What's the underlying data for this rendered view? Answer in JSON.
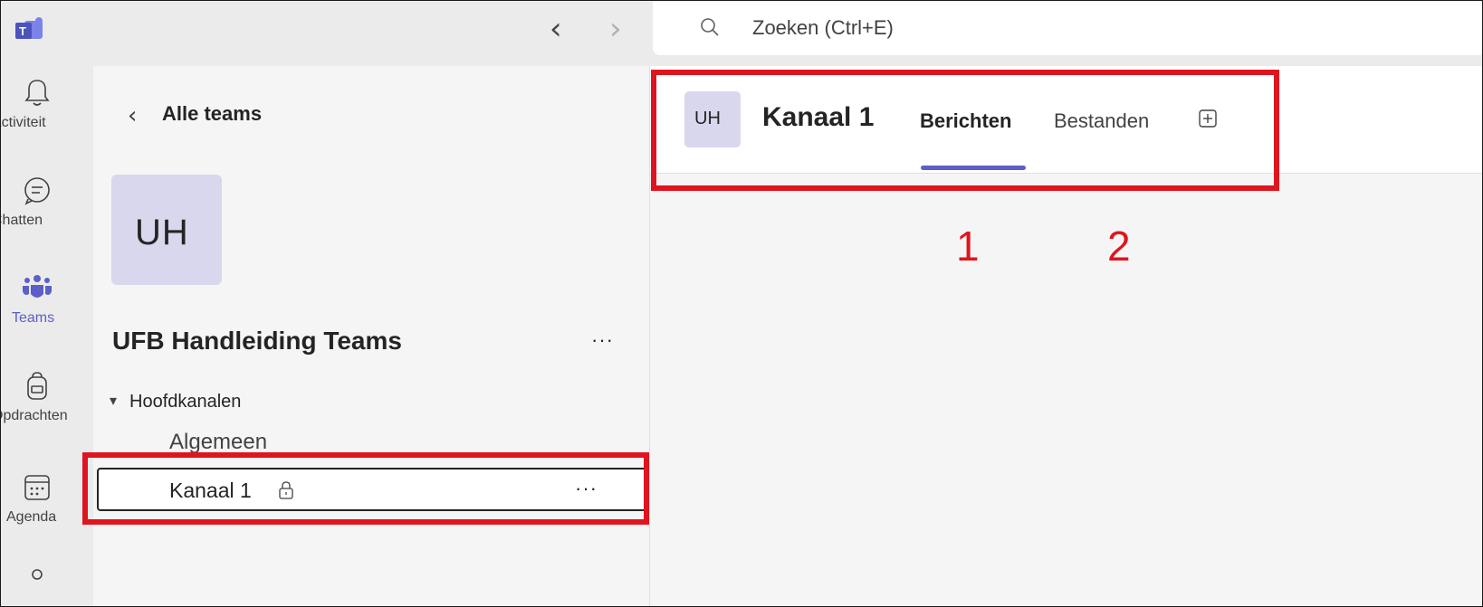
{
  "topbar": {
    "search_placeholder": "Zoeken (Ctrl+E)",
    "logo_icon": "teams-logo-icon",
    "nav_back_glyph": "‹",
    "nav_forward_glyph": "›"
  },
  "rail": {
    "items": [
      {
        "label": "Activiteit",
        "icon": "bell-icon"
      },
      {
        "label": "Chatten",
        "icon": "chat-icon"
      },
      {
        "label": "Teams",
        "icon": "teams-icon",
        "active": true
      },
      {
        "label": "Opdrachten",
        "icon": "backpack-icon"
      },
      {
        "label": "Agenda",
        "icon": "calendar-icon"
      }
    ]
  },
  "panel": {
    "back_label": "Alle teams",
    "team_initials": "UH",
    "team_name": "UFB Handleiding Teams",
    "more_glyph": "···",
    "section_label": "Hoofdkanalen",
    "channels": [
      {
        "label": "Algemeen"
      },
      {
        "label": "Kanaal 1",
        "private": true,
        "selected": true
      }
    ]
  },
  "main": {
    "channel_initials": "UH",
    "channel_title": "Kanaal 1",
    "tabs": [
      {
        "label": "Berichten",
        "active": true
      },
      {
        "label": "Bestanden"
      }
    ]
  },
  "annotations": {
    "labels": [
      "1",
      "2"
    ],
    "color": "#e0141e"
  },
  "colors": {
    "accent": "#5b5fc7",
    "avatar_bg": "#d9d7ee"
  }
}
